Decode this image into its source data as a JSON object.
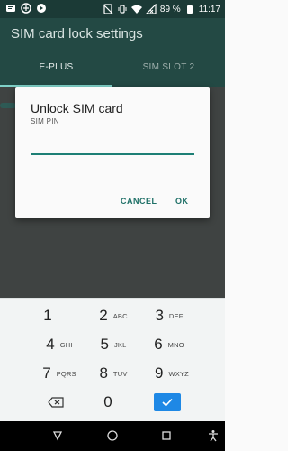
{
  "status_bar": {
    "battery_percent": "89 %",
    "time": "11:17"
  },
  "app_bar": {
    "title": "SIM card lock settings"
  },
  "tabs": [
    {
      "label": "E-PLUS",
      "selected": true
    },
    {
      "label": "SIM SLOT 2",
      "selected": false
    }
  ],
  "dialog": {
    "title": "Unlock SIM card",
    "subtitle": "SIM PIN",
    "pin_value": "",
    "cancel_label": "CANCEL",
    "ok_label": "OK"
  },
  "keypad": {
    "keys": [
      {
        "num": "1",
        "letters": ""
      },
      {
        "num": "2",
        "letters": "ABC"
      },
      {
        "num": "3",
        "letters": "DEF"
      },
      {
        "num": "4",
        "letters": "GHI"
      },
      {
        "num": "5",
        "letters": "JKL"
      },
      {
        "num": "6",
        "letters": "MNO"
      },
      {
        "num": "7",
        "letters": "PQRS"
      },
      {
        "num": "8",
        "letters": "TUV"
      },
      {
        "num": "9",
        "letters": "WXYZ"
      },
      {
        "num": "0",
        "letters": ""
      }
    ],
    "done_color": "#1e88e5"
  },
  "colors": {
    "app_bar": "#234944",
    "accent": "#1d7f75",
    "tab_indicator": "#7fd1c8"
  }
}
